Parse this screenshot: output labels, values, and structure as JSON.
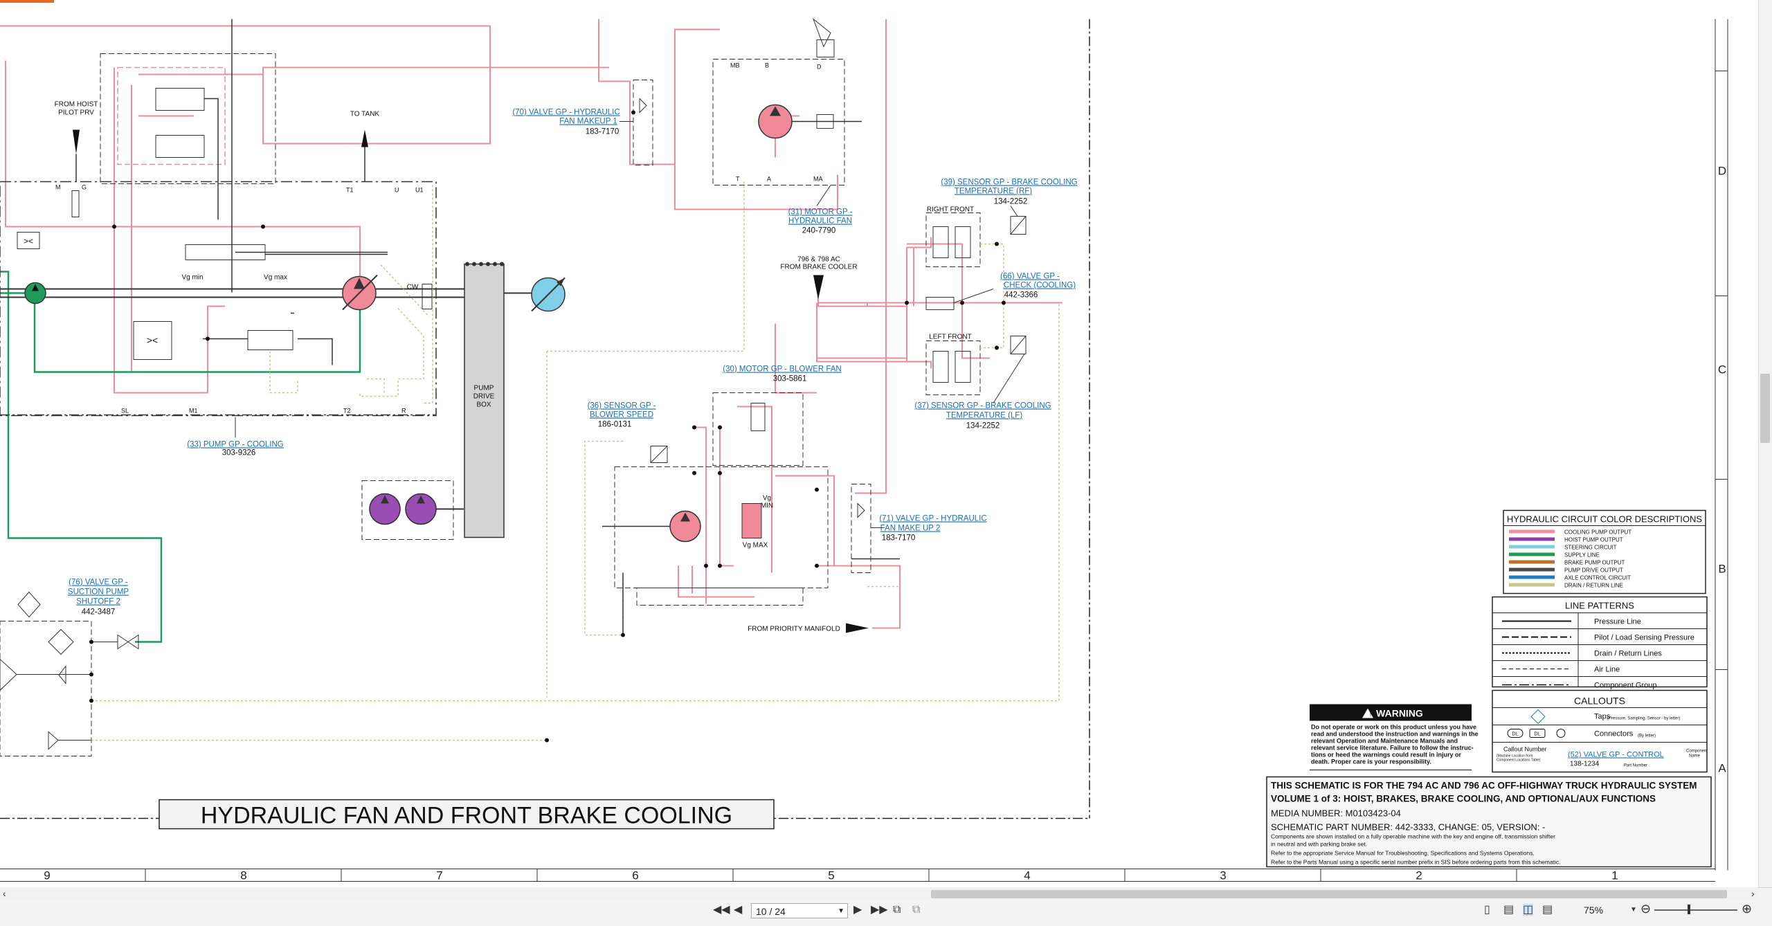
{
  "sheet_title": "HYDRAULIC FAN AND FRONT BRAKE COOLING",
  "components": {
    "c76": {
      "name1": "(76) VALVE GP -",
      "name2": "SUCTION PUMP",
      "name3": "SHUTOFF 2",
      "part": "442-3487"
    },
    "c33": {
      "name": "(33) PUMP GP - COOLING",
      "part": "303-9326"
    },
    "c70": {
      "name1": "(70) VALVE GP - HYDRAULIC",
      "name2": "FAN MAKEUP 1",
      "part": "183-7170"
    },
    "c31": {
      "name1": "(31) MOTOR GP -",
      "name2": "HYDRAULIC FAN",
      "part": "240-7790"
    },
    "c39": {
      "name1": "(39) SENSOR GP - BRAKE COOLING",
      "name2": "TEMPERATURE (RF)",
      "part": "134-2252"
    },
    "c66": {
      "name1": "(66) VALVE GP -",
      "name2": "CHECK (COOLING)",
      "part": "442-3366"
    },
    "c37": {
      "name1": "(37) SENSOR GP - BRAKE COOLING",
      "name2": "TEMPERATURE (LF)",
      "part": "134-2252"
    },
    "c30": {
      "name": "(30) MOTOR GP - BLOWER FAN",
      "part": "303-5861"
    },
    "c36": {
      "name1": "(36) SENSOR GP -",
      "name2": "BLOWER SPEED",
      "part": "186-0131"
    },
    "c71": {
      "name1": "(71) VALVE GP - HYDRAULIC",
      "name2": "FAN MAKE UP 2",
      "part": "183-7170"
    }
  },
  "labels": {
    "from_hoist_1": "FROM HOIST",
    "from_hoist_2": "PILOT PRV",
    "to_tank": "TO TANK",
    "vg_min": "Vg min",
    "vg_max": "Vg max",
    "cw": "CW",
    "pump_drive_1": "PUMP",
    "pump_drive_2": "DRIVE",
    "pump_drive_3": "BOX",
    "ac_1": "796 & 798 AC",
    "ac_2": "FROM BRAKE COOLER",
    "right_front": "RIGHT FRONT",
    "left_front": "LEFT FRONT",
    "from_priority": "FROM PRIORITY MANIFOLD",
    "vg_min2a": "Vg",
    "vg_min2b": "MIN",
    "vg_max2": "Vg MAX"
  },
  "ports": {
    "m": "M",
    "g": "G",
    "t1": "T1",
    "u": "U",
    "u1": "U1",
    "sl": "SL",
    "m1": "M1",
    "t2": "T2",
    "r": "R",
    "mb": "MB",
    "b": "B",
    "d": "D",
    "t": "T",
    "a": "A",
    "ma": "MA"
  },
  "legend": {
    "color_title": "HYDRAULIC CIRCUIT COLOR DESCRIPTIONS",
    "colors": [
      {
        "label": "COOLING PUMP OUTPUT",
        "color": "#f08fa0"
      },
      {
        "label": "HOIST PUMP OUTPUT",
        "color": "#8e3fa6"
      },
      {
        "label": "STEERING CIRCUIT",
        "color": "#7fcfd8"
      },
      {
        "label": "SUPPLY LINE",
        "color": "#1f9a5a"
      },
      {
        "label": "BRAKE PUMP OUTPUT",
        "color": "#b8722a"
      },
      {
        "label": "PUMP DRIVE OUTPUT",
        "color": "#4a4a4a"
      },
      {
        "label": "AXLE CONTROL CIRCUIT",
        "color": "#1c7dc1"
      },
      {
        "label": "DRAIN / RETURN LINE",
        "color": "#c9c48a"
      }
    ],
    "patterns_title": "LINE PATTERNS",
    "patterns": [
      "Pressure Line",
      "Pilot / Load Sensing Pressure",
      "Drain / Return Lines",
      "Air Line",
      "Component Group"
    ],
    "callouts_title": "CALLOUTS",
    "taps_label": "Taps",
    "taps_note": "(Pressure, Sampling, Sensor - by letter)",
    "connectors_label": "Connectors",
    "connectors_note": "(By letter)",
    "dl1": "DL",
    "dl2": "DL",
    "callout_number": "Callout Number",
    "callout_note1": "(Machine Location from",
    "callout_note2": "Component Locations Table)",
    "component_name1": "Component",
    "component_name2": "Name",
    "example_link": "(52) VALVE GP - CONTROL",
    "example_part": "138-1234",
    "part_number": "Part Number"
  },
  "warning": {
    "title": "WARNING",
    "lines": [
      "Do not operate or work on this product unless you have",
      "read and understood the instruction and warnings in the",
      "relevant Operation and Maintenance Manuals and",
      "relevant service literature. Failure to follow the instruc-",
      "tions or heed the warnings could result in injury or",
      "death. Proper care is your responsibility."
    ]
  },
  "titleblock": {
    "line1": "THIS SCHEMATIC IS FOR THE 794 AC AND 796 AC OFF-HIGHWAY TRUCK HYDRAULIC SYSTEM",
    "line2": "VOLUME 1 of 3: HOIST, BRAKES, BRAKE COOLING, AND OPTIONAL/AUX FUNCTIONS",
    "media": "MEDIA NUMBER: M0103423-04",
    "part": "SCHEMATIC PART NUMBER: 442-3333, CHANGE: 05, VERSION: -",
    "note1": "Components are shown installed on a fully operable machine with the key and engine off, transmission shifter",
    "note2": "in neutral and with parking brake set.",
    "note3": "Refer to the appropriate Service Manual for Troubleshooting, Specifications and Systems Operations.",
    "note4": "Refer to the Parts Manual using a specific serial number prefix in SIS before ordering parts from this schematic."
  },
  "grid_cols": [
    "9",
    "8",
    "7",
    "6",
    "5",
    "4",
    "3",
    "2",
    "1"
  ],
  "grid_rows": [
    "D",
    "C",
    "B",
    "A"
  ],
  "viewer": {
    "page": "10 / 24",
    "zoom": "75%"
  }
}
